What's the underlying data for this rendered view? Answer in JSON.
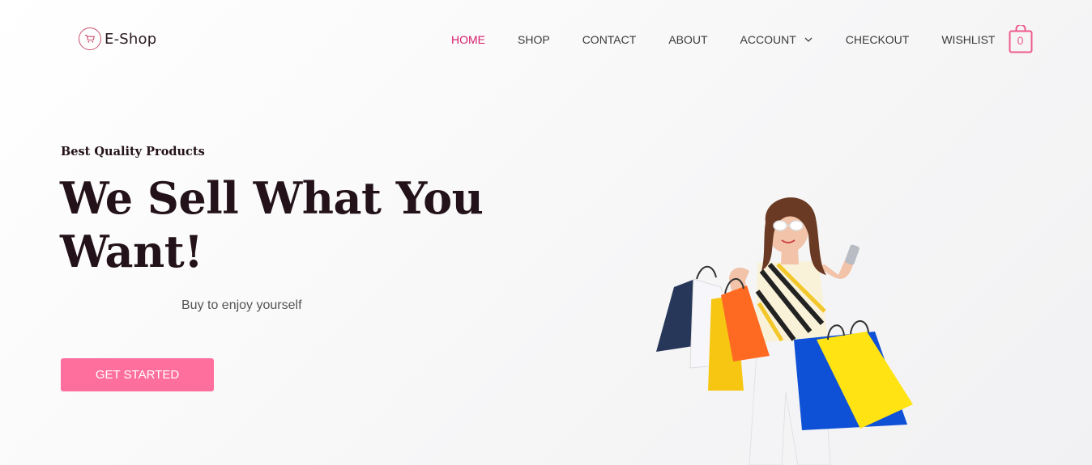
{
  "brand": {
    "name": "E-Shop",
    "icon": "shopping-cart-icon",
    "color": "#c9536f"
  },
  "nav": {
    "items": [
      {
        "label": "HOME",
        "active": true
      },
      {
        "label": "SHOP"
      },
      {
        "label": "CONTACT"
      },
      {
        "label": "ABOUT"
      },
      {
        "label": "ACCOUNT",
        "dropdown": true
      },
      {
        "label": "CHECKOUT"
      },
      {
        "label": "WISHLIST"
      }
    ],
    "active_color": "#d61c6b"
  },
  "cart": {
    "count": "0",
    "icon": "shopping-bag-icon",
    "color": "#ef5a8a"
  },
  "hero": {
    "eyebrow": "Best Quality Products",
    "headline": "We Sell What You Want!",
    "tagline": "Buy to enjoy yourself",
    "cta_label": "GET STARTED",
    "cta_color": "#ff6f9e",
    "image": "woman-with-shopping-bags"
  }
}
